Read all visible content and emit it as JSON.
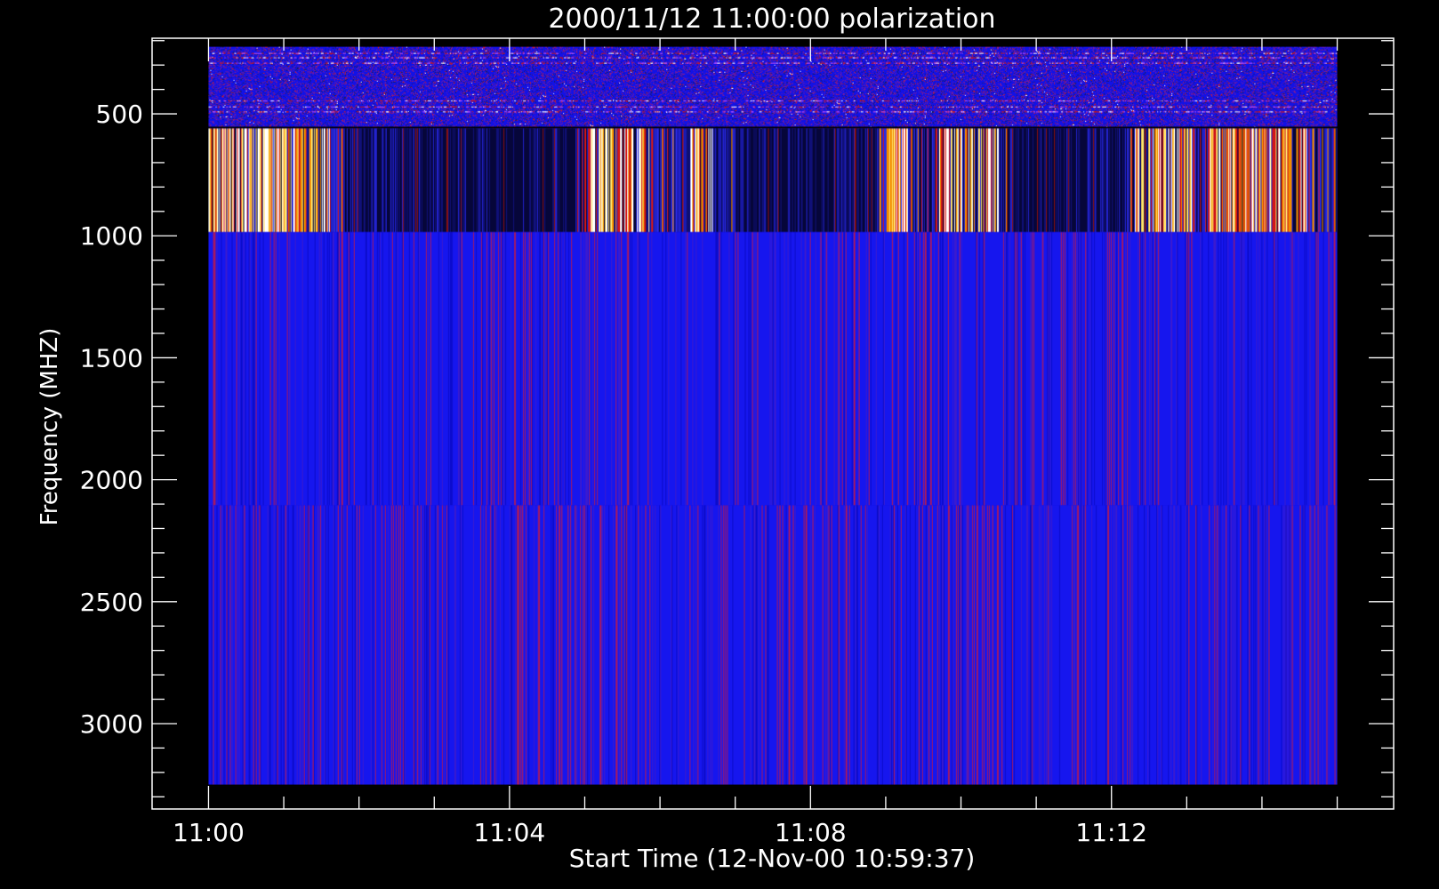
{
  "chart_data": {
    "type": "heatmap",
    "title": "2000/11/12 11:00:00 polarization",
    "xlabel": "Start Time (12-Nov-00 10:59:37)",
    "ylabel": "Frequency (MHZ)",
    "x_tick_labels": [
      "11:00",
      "11:04",
      "11:08",
      "11:12"
    ],
    "y_tick_labels": [
      "500",
      "1000",
      "1500",
      "2000",
      "2500",
      "3000"
    ],
    "y_tick_values": [
      500,
      1000,
      1500,
      2000,
      2500,
      3000
    ],
    "x_range_minutes": [
      -0.75,
      15.75
    ],
    "y_range_mhz": [
      190,
      3350
    ],
    "y_reversed": true,
    "background": "#000000",
    "colors": {
      "axes": "#ffffff",
      "base": "#1212e6",
      "dark": "#06063a",
      "red": "#d01818",
      "orange": "#f08a00",
      "yellow": "#ffe16a",
      "white": "#ffffff"
    },
    "data_extent": {
      "time_minutes": [
        0,
        15
      ],
      "freq_mhz": [
        225,
        3250
      ]
    },
    "bands": [
      {
        "name": "noisy",
        "freq_mhz": [
          225,
          560
        ]
      },
      {
        "name": "burst",
        "freq_mhz": [
          560,
          985
        ]
      },
      {
        "name": "quiet-upper",
        "freq_mhz": [
          985,
          2105
        ]
      },
      {
        "name": "quiet-lower",
        "freq_mhz": [
          2105,
          3250
        ]
      }
    ],
    "bright_intervals_minutes": [
      [
        0.0,
        1.6
      ],
      [
        5.0,
        5.9
      ],
      [
        6.4,
        6.7
      ],
      [
        9.0,
        9.3
      ],
      [
        9.7,
        10.5
      ],
      [
        12.3,
        13.1
      ],
      [
        13.3,
        14.6
      ]
    ],
    "dark_intervals_minutes": [
      [
        1.8,
        4.9
      ],
      [
        7.0,
        8.9
      ],
      [
        10.6,
        12.2
      ]
    ]
  }
}
